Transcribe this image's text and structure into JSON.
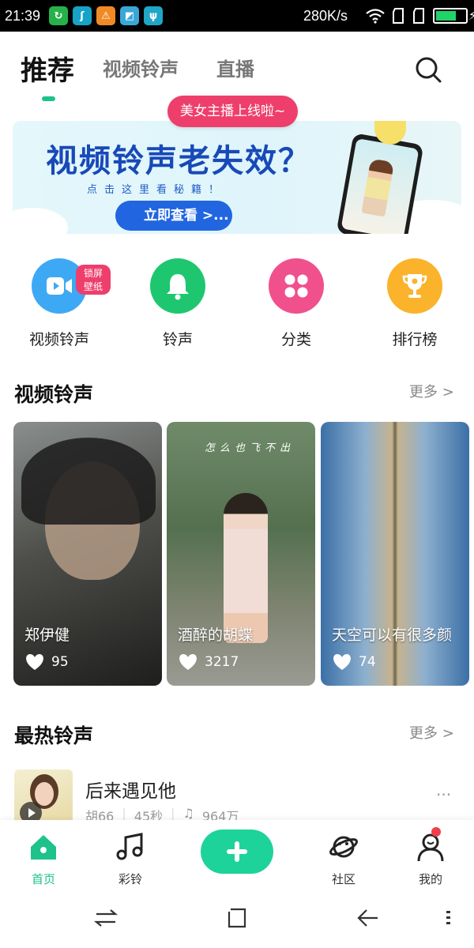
{
  "status_bar": {
    "time": "21:39",
    "net_speed": "280K/s",
    "battery_level": 0.7
  },
  "top_tabs": [
    {
      "label": "推荐",
      "active": true
    },
    {
      "label": "视频铃声",
      "active": false
    },
    {
      "label": "直播",
      "active": false
    }
  ],
  "live_bubble": "美女主播上线啦~",
  "banner": {
    "title": "视频铃声老失效？",
    "subtitle": "点击这里看秘籍！",
    "button": "立即查看 >..."
  },
  "categories": [
    {
      "label": "视频铃声",
      "icon": "video-camera-icon",
      "color": "#3da9f5",
      "badge": "锁屏壁纸"
    },
    {
      "label": "铃声",
      "icon": "bell-icon",
      "color": "#1ec76f",
      "badge": ""
    },
    {
      "label": "分类",
      "icon": "grid-icon",
      "color": "#f0508c",
      "badge": ""
    },
    {
      "label": "排行榜",
      "icon": "trophy-icon",
      "color": "#fbb32b",
      "badge": ""
    }
  ],
  "video_section": {
    "title": "视频铃声",
    "more": "更多 >",
    "cards": [
      {
        "title": "郑伊健",
        "likes": "95"
      },
      {
        "title": "酒醉的胡蝶",
        "likes": "3217",
        "overlay": "怎么也飞不出"
      },
      {
        "title": "天空可以有很多颜",
        "likes": "74"
      }
    ]
  },
  "hot_section": {
    "title": "最热铃声",
    "more": "更多 >",
    "songs": [
      {
        "title": "后来遇见他",
        "artist": "胡66",
        "duration": "45秒",
        "plays": "964万"
      }
    ]
  },
  "bottom_nav": [
    {
      "label": "首页",
      "icon": "home-icon",
      "active": true
    },
    {
      "label": "彩铃",
      "icon": "music-note-icon",
      "active": false
    },
    {
      "label": "",
      "icon": "plus-icon",
      "active": false
    },
    {
      "label": "社区",
      "icon": "planet-icon",
      "active": false
    },
    {
      "label": "我的",
      "icon": "user-icon",
      "active": false
    }
  ],
  "colors": {
    "accent": "#1ec28b",
    "live_pink": "#ee3f6c",
    "banner_blue": "#1849b8"
  }
}
